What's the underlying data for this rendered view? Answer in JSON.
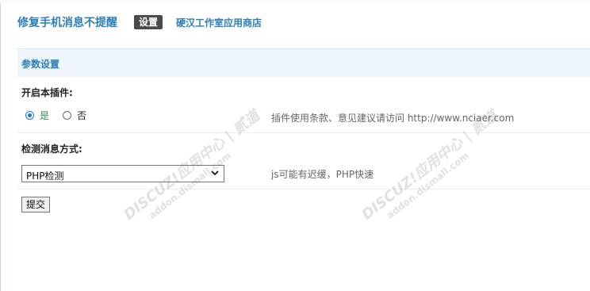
{
  "header": {
    "title": "修复手机消息不提醒",
    "active_tab": "设置",
    "store_link": "硬汉工作室应用商店"
  },
  "section": {
    "title": "参数设置"
  },
  "plugin_enable": {
    "label": "开启本插件:",
    "options": [
      "是",
      "否"
    ],
    "selected": "是",
    "hint": "插件使用条款、意见建议请访问 http://www.nciaer.com"
  },
  "detect_method": {
    "label": "检测消息方式:",
    "selected": "PHP检测",
    "hint": "js可能有迟缓，PHP快速"
  },
  "submit_label": "提交",
  "watermark": {
    "brand": "DISCUZ!应用中心 | 贰道",
    "url": "addon.dismall.com"
  }
}
